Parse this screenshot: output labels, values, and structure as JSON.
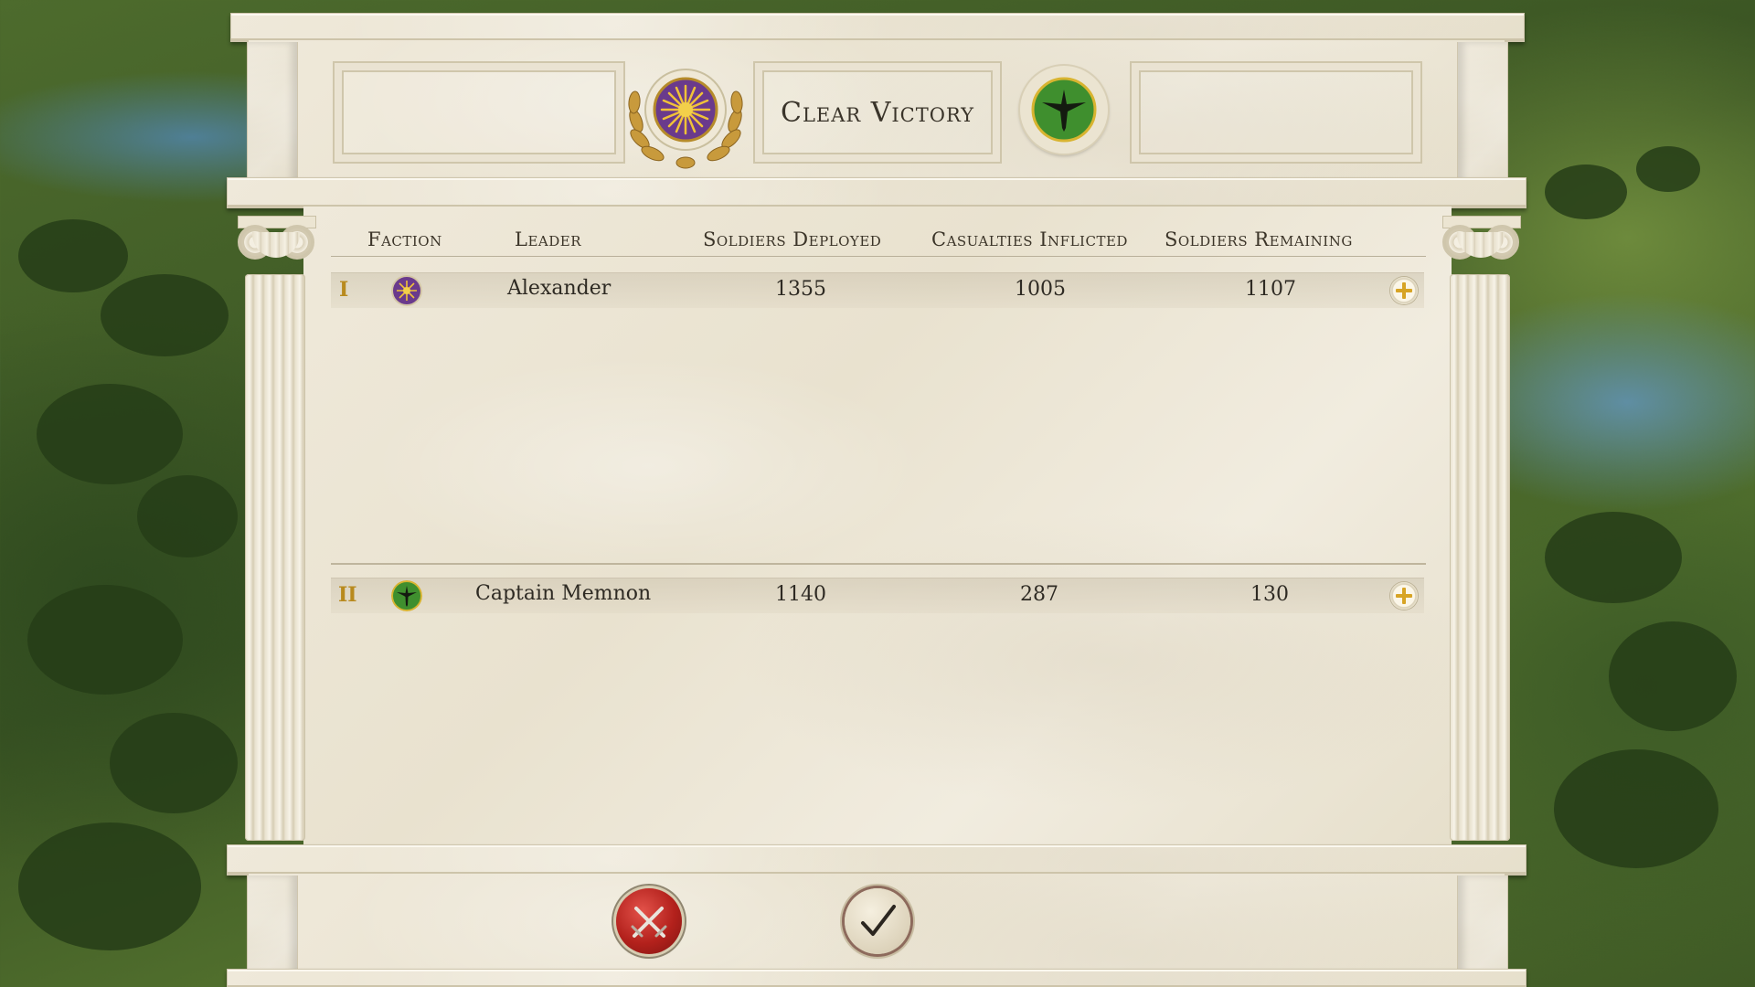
{
  "header": {
    "left_box_text": "",
    "result_title": "Clear Victory",
    "right_box_text": ""
  },
  "emblems": {
    "player_faction": "macedon-sun-emblem",
    "enemy_faction": "green-eagle-emblem"
  },
  "table": {
    "columns": [
      "Faction",
      "Leader",
      "Soldiers Deployed",
      "Casualties Inflicted",
      "Soldiers Remaining"
    ],
    "rows": [
      {
        "rank": "I",
        "faction_icon": "macedon-sun-emblem",
        "leader": "Alexander",
        "deployed": "1355",
        "inflicted": "1005",
        "remaining": "1107"
      },
      {
        "rank": "II",
        "faction_icon": "green-eagle-emblem",
        "leader": "Captain Memnon",
        "deployed": "1140",
        "inflicted": "287",
        "remaining": "130"
      }
    ]
  },
  "footer": {
    "cancel_icon": "crossed-swords-icon",
    "confirm_icon": "checkmark-icon"
  },
  "colors": {
    "purple_emblem": "#6a3a8c",
    "gold": "#e7b728",
    "green_emblem": "#3f8f2e",
    "cancel_red": "#b3211c"
  }
}
